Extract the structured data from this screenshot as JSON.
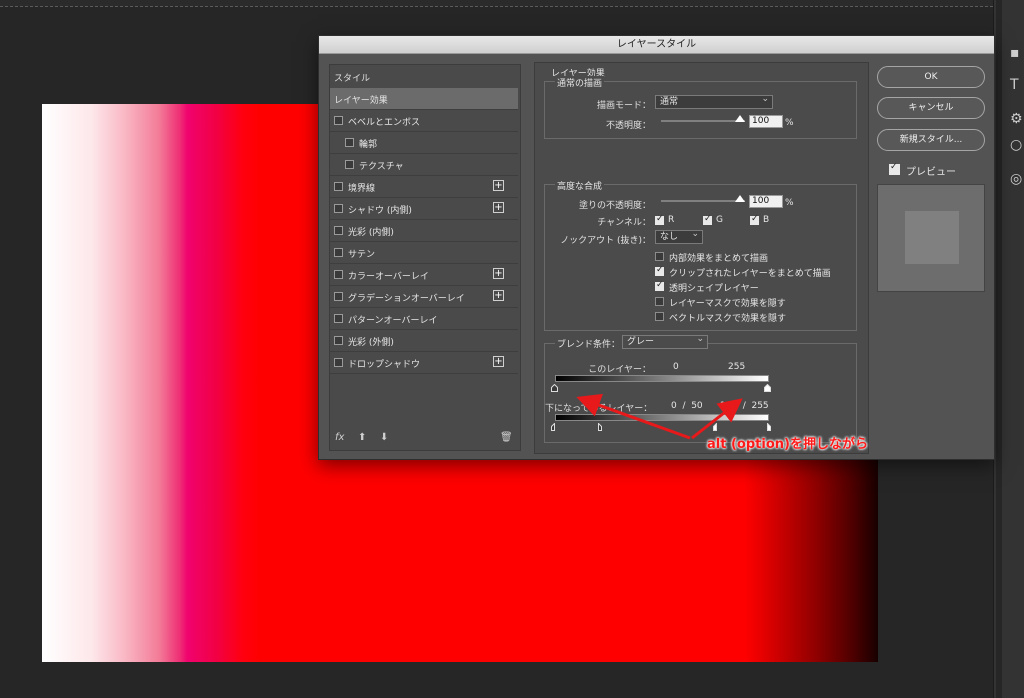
{
  "dialog": {
    "title": "レイヤースタイル"
  },
  "styles_list": {
    "header": "スタイル",
    "selected": "レイヤー効果",
    "items": [
      {
        "label": "ベベルとエンボス",
        "plus": false,
        "indent": 0
      },
      {
        "label": "輪郭",
        "plus": false,
        "indent": 1
      },
      {
        "label": "テクスチャ",
        "plus": false,
        "indent": 1
      },
      {
        "label": "境界線",
        "plus": true,
        "indent": 0
      },
      {
        "label": "シャドウ (内側)",
        "plus": true,
        "indent": 0
      },
      {
        "label": "光彩 (内側)",
        "plus": false,
        "indent": 0
      },
      {
        "label": "サテン",
        "plus": false,
        "indent": 0
      },
      {
        "label": "カラーオーバーレイ",
        "plus": true,
        "indent": 0
      },
      {
        "label": "グラデーションオーバーレイ",
        "plus": true,
        "indent": 0
      },
      {
        "label": "パターンオーバーレイ",
        "plus": false,
        "indent": 0
      },
      {
        "label": "光彩 (外側)",
        "plus": false,
        "indent": 0
      },
      {
        "label": "ドロップシャドウ",
        "plus": true,
        "indent": 0
      }
    ],
    "footer": {
      "fx": "fx",
      "up_icon": "arrow-up-icon",
      "down_icon": "arrow-down-icon",
      "trash_icon": "trash-icon"
    }
  },
  "effects": {
    "section_title": "レイヤー効果",
    "normal": {
      "title": "通常の描画",
      "blend_mode_label": "描画モード：",
      "blend_mode_value": "通常",
      "opacity_label": "不透明度：",
      "opacity_value": "100",
      "percent": "%"
    },
    "advanced": {
      "title": "高度な合成",
      "fill_opacity_label": "塗りの不透明度：",
      "fill_opacity_value": "100",
      "percent": "%",
      "channels_label": "チャンネル：",
      "ch_r": "R",
      "ch_g": "G",
      "ch_b": "B",
      "knockout_label": "ノックアウト (抜き)：",
      "knockout_value": "なし",
      "options": [
        {
          "label": "内部効果をまとめて描画",
          "checked": false
        },
        {
          "label": "クリップされたレイヤーをまとめて描画",
          "checked": true
        },
        {
          "label": "透明シェイプレイヤー",
          "checked": true
        },
        {
          "label": "レイヤーマスクで効果を隠す",
          "checked": false
        },
        {
          "label": "ベクトルマスクで効果を隠す",
          "checked": false
        }
      ]
    },
    "blend_if": {
      "label": "ブレンド条件：",
      "value": "グレー",
      "this_layer_label": "このレイヤー：",
      "this_layer_low": "0",
      "this_layer_high": "255",
      "underlying_label": "下になっているレイヤー：",
      "underlying_values": "0  /  50      196  /  255"
    }
  },
  "buttons": {
    "ok": "OK",
    "cancel": "キャンセル",
    "new_style": "新規スタイル...",
    "preview_label": "プレビュー",
    "preview_checked": true
  },
  "annotation": {
    "text": "alt (option)を押しながら",
    "color": "#e8191b"
  }
}
